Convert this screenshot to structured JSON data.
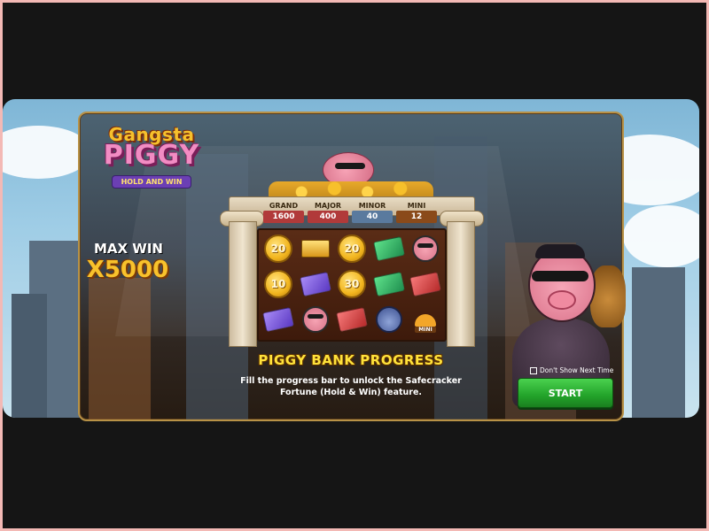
{
  "game": {
    "logo_top": "Gangsta",
    "logo_main": "PIGGY",
    "logo_sub": "HOLD AND WIN"
  },
  "max_win": {
    "label": "MAX WIN",
    "value": "X5000"
  },
  "jackpots": [
    {
      "name": "GRAND",
      "value": "1600",
      "color": "#b13a3a"
    },
    {
      "name": "MAJOR",
      "value": "400",
      "color": "#b13a3a"
    },
    {
      "name": "MINOR",
      "value": "40",
      "color": "#5a7a9e"
    },
    {
      "name": "MINI",
      "value": "12",
      "color": "#8a4a1a"
    }
  ],
  "reels": {
    "columns": [
      [
        {
          "type": "coin",
          "value": "20"
        },
        {
          "type": "coin",
          "value": "10"
        },
        {
          "type": "cash-purple"
        }
      ],
      [
        {
          "type": "gold"
        },
        {
          "type": "cash-purple"
        },
        {
          "type": "pig"
        }
      ],
      [
        {
          "type": "coin",
          "value": "20"
        },
        {
          "type": "coin",
          "value": "30"
        },
        {
          "type": "cash-red"
        }
      ],
      [
        {
          "type": "cash-green"
        },
        {
          "type": "cash-green"
        },
        {
          "type": "cop"
        }
      ],
      [
        {
          "type": "pig"
        },
        {
          "type": "cash-red"
        },
        {
          "type": "bag",
          "label": "MINI"
        }
      ]
    ]
  },
  "progress": {
    "title": "PIGGY BANK PROGRESS",
    "description": "Fill the progress bar to unlock the Safecracker Fortune (Hold & Win) feature."
  },
  "controls": {
    "dont_show_label": "Don't Show Next Time",
    "start_label": "START"
  }
}
